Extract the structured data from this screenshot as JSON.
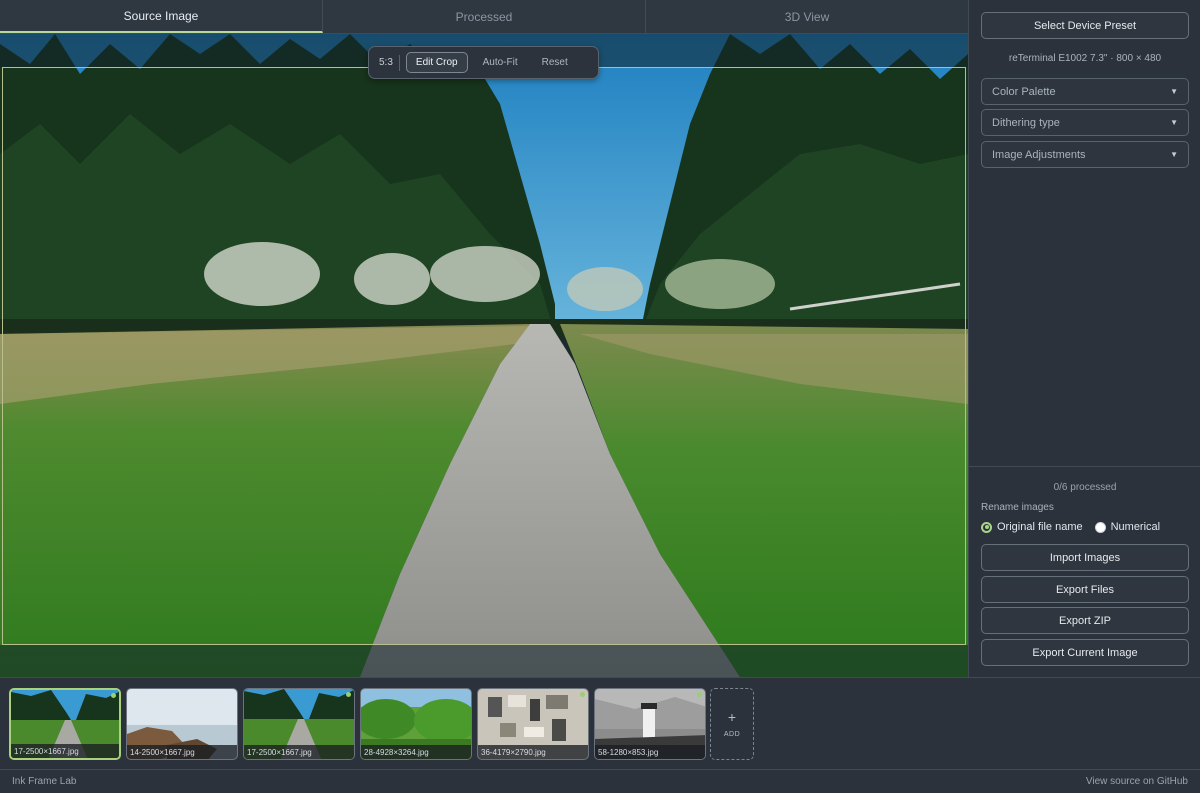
{
  "tabs": [
    {
      "label": "Source Image",
      "active": true
    },
    {
      "label": "Processed",
      "active": false
    },
    {
      "label": "3D View",
      "active": false
    }
  ],
  "crop_toolbar": {
    "ratio": "5:3",
    "edit_crop": "Edit Crop",
    "auto_fit": "Auto-Fit",
    "reset": "Reset"
  },
  "panel": {
    "preset_button": "Select Device Preset",
    "device_info": "reTerminal E1002 7.3\" · 800 × 480",
    "dropdowns": [
      {
        "label": "Color Palette",
        "icon": "triangle-down-icon"
      },
      {
        "label": "Dithering type",
        "icon": "triangle-down-icon"
      },
      {
        "label": "Image Adjustments",
        "icon": "triangle-down-icon"
      }
    ],
    "processed_status": "0/6 processed",
    "rename_label": "Rename images",
    "rename_options": [
      {
        "label": "Original file name",
        "checked": true
      },
      {
        "label": "Numerical",
        "checked": false
      }
    ],
    "actions": [
      "Import Images",
      "Export Files",
      "Export ZIP",
      "Export Current Image"
    ]
  },
  "filmstrip": {
    "thumbnails": [
      {
        "caption": "17-2500×1667.jpg",
        "scene": "forest-path",
        "selected": true,
        "status": "processed-dot"
      },
      {
        "caption": "14-2500×1667.jpg",
        "scene": "coast-rocks",
        "selected": false,
        "status": ""
      },
      {
        "caption": "17-2500×1667.jpg",
        "scene": "forest-path",
        "selected": false,
        "status": "processed-dot"
      },
      {
        "caption": "28-4928×3264.jpg",
        "scene": "green-foliage",
        "selected": false,
        "status": ""
      },
      {
        "caption": "36-4179×2790.jpg",
        "scene": "flatlay-items",
        "selected": false,
        "status": "processed-dot"
      },
      {
        "caption": "58-1280×853.jpg",
        "scene": "lighthouse-bw",
        "selected": false,
        "status": "processed-dot"
      }
    ],
    "add_label": "ADD",
    "add_icon": "plus-icon"
  },
  "footer": {
    "app_name": "Ink Frame Lab",
    "source_link": "View source on GitHub"
  },
  "colors": {
    "accent": "#a8d27e",
    "background": "#2b323b",
    "border": "#414b56"
  }
}
